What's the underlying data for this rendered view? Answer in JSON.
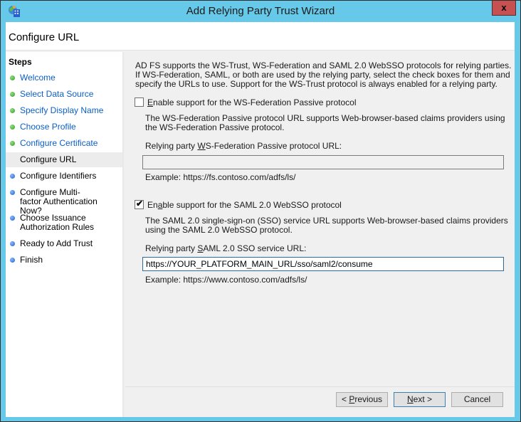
{
  "window": {
    "title": "Add Relying Party Trust Wizard",
    "close_label": "x",
    "app_icon": "adfs-wizard-icon"
  },
  "header": {
    "title": "Configure URL"
  },
  "steps": {
    "heading": "Steps",
    "items": [
      {
        "label": "Welcome",
        "status": "done"
      },
      {
        "label": "Select Data Source",
        "status": "done"
      },
      {
        "label": "Specify Display Name",
        "status": "done"
      },
      {
        "label": "Choose Profile",
        "status": "done"
      },
      {
        "label": "Configure Certificate",
        "status": "done"
      },
      {
        "label": "Configure URL",
        "status": "current"
      },
      {
        "label": "Configure Identifiers",
        "status": "todo"
      },
      {
        "label": "Configure Multi-factor Authentication Now?",
        "status": "todo"
      },
      {
        "label": "Choose Issuance Authorization Rules",
        "status": "todo"
      },
      {
        "label": "Ready to Add Trust",
        "status": "todo"
      },
      {
        "label": "Finish",
        "status": "todo"
      }
    ]
  },
  "main": {
    "intro": "AD FS supports the WS-Trust, WS-Federation and SAML 2.0 WebSSO protocols for relying parties.  If WS-Federation, SAML, or both are used by the relying party, select the check boxes for them and specify the URLs to use.  Support for the WS-Trust protocol is always enabled for a relying party.",
    "wsfed": {
      "checkbox_mnemonic": "E",
      "checkbox_rest": "nable support for the WS-Federation Passive protocol",
      "checked": false,
      "description": "The WS-Federation Passive protocol URL supports Web-browser-based claims providers using the WS-Federation Passive protocol.",
      "field_label_pre": "Relying party ",
      "field_label_mnemonic": "W",
      "field_label_post": "S-Federation Passive protocol URL:",
      "value": "",
      "example": "Example: https://fs.contoso.com/adfs/ls/"
    },
    "saml": {
      "checkbox_pre": "En",
      "checkbox_mnemonic": "a",
      "checkbox_post": "ble support for the SAML 2.0 WebSSO protocol",
      "checked": true,
      "description": "The SAML 2.0 single-sign-on (SSO) service URL supports Web-browser-based claims providers using the SAML 2.0 WebSSO protocol.",
      "field_label_pre": "Relying party ",
      "field_label_mnemonic": "S",
      "field_label_post": "AML 2.0 SSO service URL:",
      "value": "https://YOUR_PLATFORM_MAIN_URL/sso/saml2/consume",
      "example": "Example: https://www.contoso.com/adfs/ls/"
    }
  },
  "buttons": {
    "previous_pre": "< ",
    "previous_mnemonic": "P",
    "previous_post": "revious",
    "next_mnemonic": "N",
    "next_post": "ext >",
    "cancel": "Cancel"
  }
}
